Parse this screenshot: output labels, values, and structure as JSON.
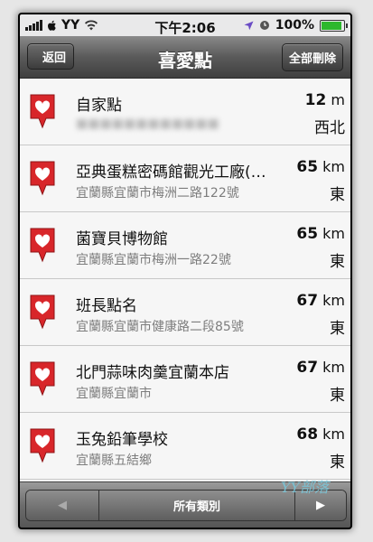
{
  "status_bar": {
    "carrier": "YY",
    "time": "下午2:06",
    "battery": "100%",
    "battery_level": 1.0
  },
  "nav": {
    "back_label": "返回",
    "title": "喜愛點",
    "clear_all_label": "全部刪除"
  },
  "places": [
    {
      "name": "自家點",
      "address": "■■■■■■■■■■■■",
      "distance": "12",
      "unit": "m",
      "direction": "西北"
    },
    {
      "name": "亞典蛋糕密碼館觀光工廠(…",
      "address": "宜蘭縣宜蘭市梅洲二路122號",
      "distance": "65",
      "unit": "km",
      "direction": "東"
    },
    {
      "name": "菌寶貝博物館",
      "address": "宜蘭縣宜蘭市梅洲一路22號",
      "distance": "65",
      "unit": "km",
      "direction": "東"
    },
    {
      "name": "班長點名",
      "address": "宜蘭縣宜蘭市健康路二段85號",
      "distance": "67",
      "unit": "km",
      "direction": "東"
    },
    {
      "name": "北門蒜味肉羹宜蘭本店",
      "address": "宜蘭縣宜蘭市",
      "distance": "67",
      "unit": "km",
      "direction": "東"
    },
    {
      "name": "玉兔鉛筆學校",
      "address": "宜蘭縣五結鄉",
      "distance": "68",
      "unit": "km",
      "direction": "東"
    }
  ],
  "toolbar": {
    "category_label": "所有類別",
    "prev_icon": "left-arrow-icon",
    "next_icon": "right-arrow-icon"
  },
  "watermark": "YY部落",
  "colors": {
    "pin_red": "#d8262a",
    "navbar_top": "#8a8a8a",
    "navbar_bottom": "#3f3f3f",
    "battery_green": "#2db82d"
  }
}
